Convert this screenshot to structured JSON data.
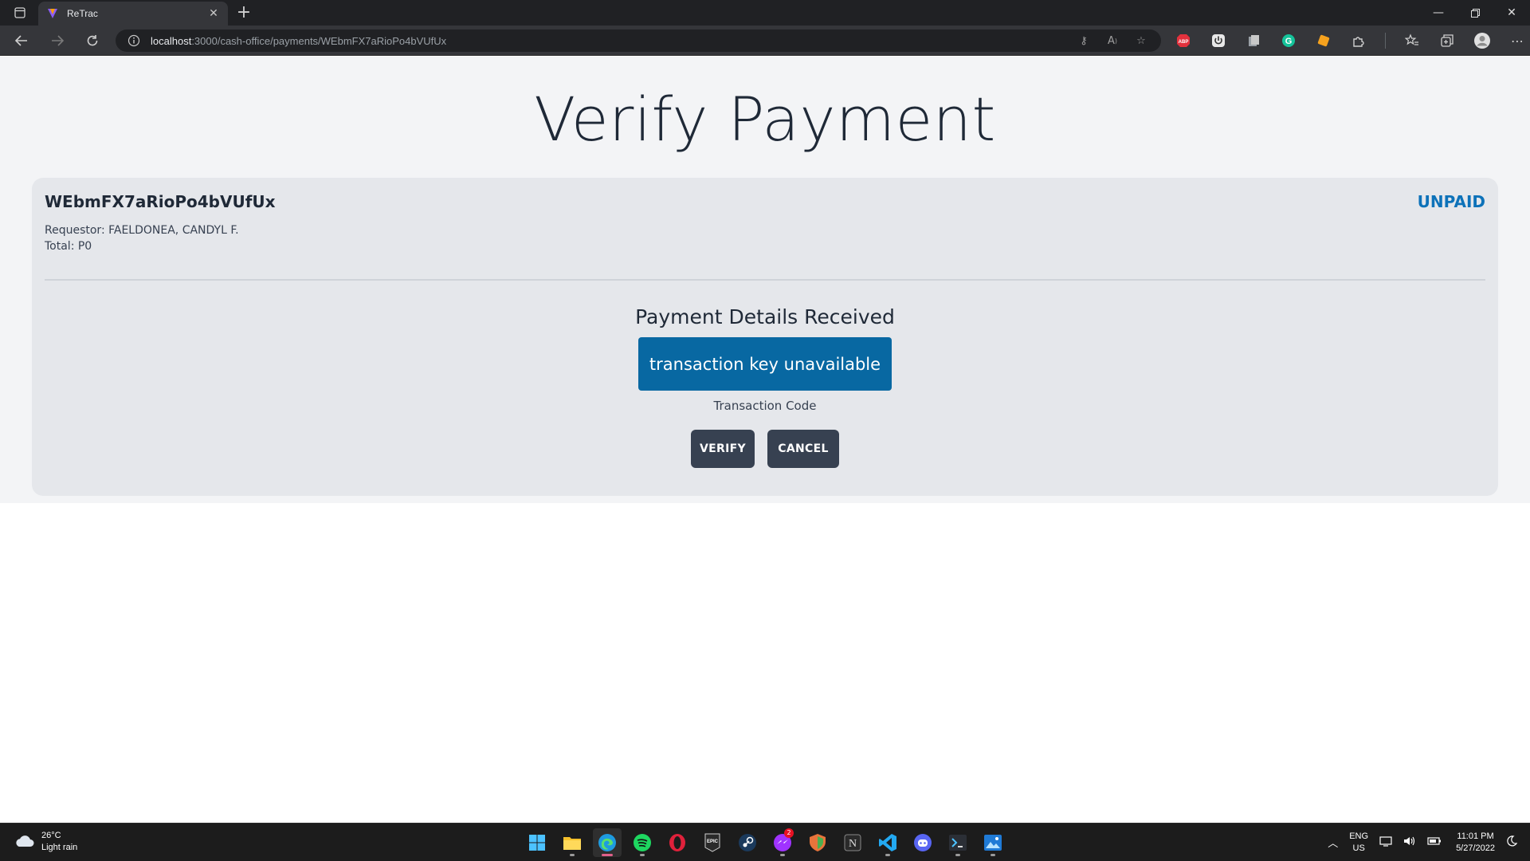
{
  "browser": {
    "tab_title": "ReTrac",
    "url_host": "localhost",
    "url_path": ":3000/cash-office/payments/WEbmFX7aRioPo4bVUfUx"
  },
  "page": {
    "title": "Verify Payment"
  },
  "payment": {
    "id": "WEbmFX7aRioPo4bVUfUx",
    "status": "UNPAID",
    "requestor": "Requestor: FAELDONEA, CANDYL F.",
    "total": "Total: P0"
  },
  "details": {
    "heading": "Payment Details Received",
    "transaction_key": "transaction key unavailable",
    "transaction_label": "Transaction Code",
    "verify_label": "VERIFY",
    "cancel_label": "CANCEL"
  },
  "taskbar": {
    "temperature": "26°C",
    "weather": "Light rain",
    "messenger_badge": "2",
    "lang": "ENG",
    "region": "US",
    "time": "11:01 PM",
    "date": "5/27/2022"
  },
  "colors": {
    "accent": "#0868a2",
    "status": "#0d72b9",
    "button": "#374151",
    "page_bg": "#f3f4f6",
    "card_bg": "#e5e7eb"
  },
  "icons": {
    "tabbar": [
      "tab-actions-icon",
      "retrac-favicon",
      "close-icon",
      "plus-icon",
      "minimize-icon",
      "restore-icon",
      "close-window-icon"
    ],
    "toolbar": [
      "back-icon",
      "forward-icon",
      "refresh-icon",
      "info-icon",
      "key-icon",
      "read-aloud-icon",
      "add-favorite-icon",
      "adblock-icon",
      "power-icon",
      "clipboard-icon",
      "grammarly-icon",
      "tag-icon",
      "extensions-icon",
      "favorites-icon",
      "collections-icon",
      "profile-icon",
      "more-icon"
    ],
    "taskbar": [
      "start-icon",
      "file-explorer-icon",
      "edge-icon",
      "spotify-icon",
      "opera-icon",
      "epic-games-icon",
      "steam-icon",
      "messenger-icon",
      "shield-app-icon",
      "notion-icon",
      "vscode-icon",
      "discord-icon",
      "terminal-icon",
      "photos-icon"
    ]
  }
}
